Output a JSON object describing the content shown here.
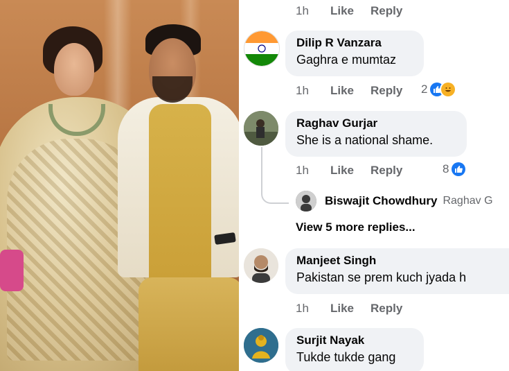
{
  "photo": {
    "description_icon": "wedding-photo"
  },
  "comments": [
    {
      "id": "top-partial",
      "meta": {
        "time": "1h",
        "like": "Like",
        "reply": "Reply"
      }
    },
    {
      "id": "dilip",
      "author": "Dilip R Vanzara",
      "text": "Gaghra e mumtaz",
      "avatar_icon": "india-flag-icon",
      "meta": {
        "time": "1h",
        "like": "Like",
        "reply": "Reply"
      },
      "reaction_count": "2",
      "reaction_icons": [
        "like-icon",
        "haha-icon"
      ]
    },
    {
      "id": "raghav",
      "author": "Raghav Gurjar",
      "text": "She is a national shame.",
      "avatar_icon": "profile-photo-icon",
      "meta": {
        "time": "1h",
        "like": "Like",
        "reply": "Reply"
      },
      "reaction_count": "8",
      "reaction_icons": [
        "like-icon"
      ],
      "replies": {
        "first_reply_author": "Biswajit Chowdhury",
        "first_reply_target": "Raghav G",
        "view_more": "View 5 more replies..."
      }
    },
    {
      "id": "manjeet",
      "author": "Manjeet Singh",
      "text": "Pakistan se prem kuch jyada h",
      "avatar_icon": "profile-photo-icon",
      "meta": {
        "time": "1h",
        "like": "Like",
        "reply": "Reply"
      }
    },
    {
      "id": "surjit",
      "author": "Surjit Nayak",
      "text": "Tukde tukde gang",
      "avatar_icon": "profile-photo-icon"
    }
  ],
  "colors": {
    "bubble_bg": "#f0f2f5",
    "meta_text": "#65676b",
    "like_blue": "#1877f2",
    "name_text": "#050505"
  }
}
